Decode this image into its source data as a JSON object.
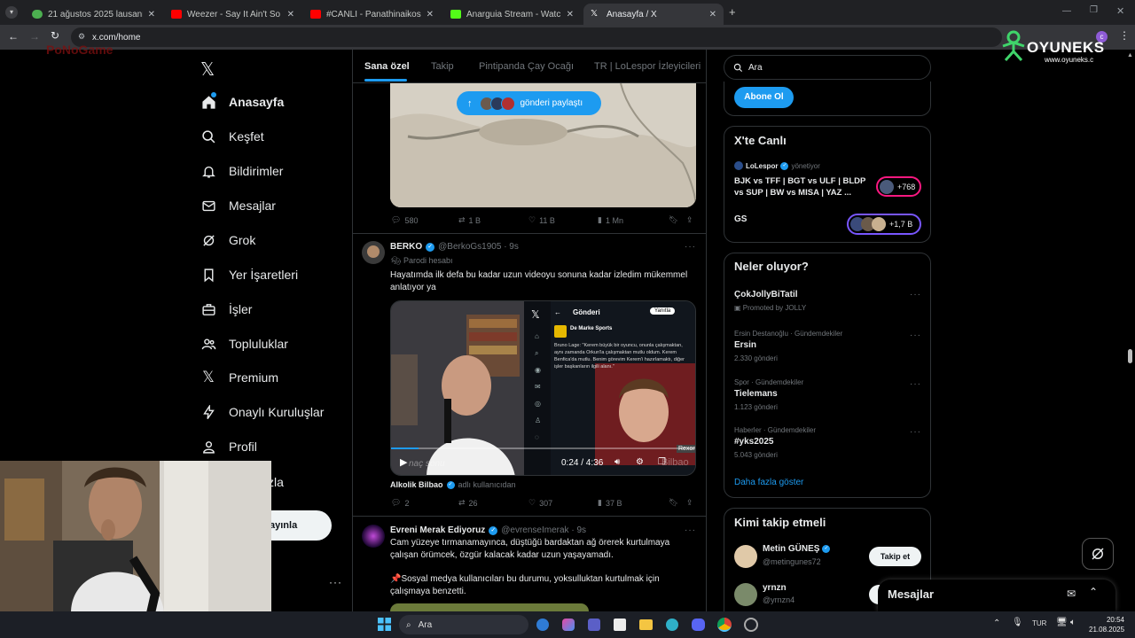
{
  "browser": {
    "tabs": [
      {
        "title": "21 ağustos 2025 lausanne-spor",
        "color": "#4caf50"
      },
      {
        "title": "Weezer - Say It Ain't So (Versio",
        "color": "#ff0000"
      },
      {
        "title": "#CANLI - Panathinaikos - Sams",
        "color": "#ff0000"
      },
      {
        "title": "Anarguia Stream - Watch Live o",
        "color": "#53fc18"
      },
      {
        "title": "Anasayfa / X",
        "color": "#ffffff"
      }
    ],
    "url": "x.com/home"
  },
  "overlay": {
    "logo_text": "OYUNEKS",
    "logo_url": "www.oyuneks.c",
    "bg_logo": "PoNoGame"
  },
  "sidebar": {
    "items": [
      {
        "label": "Anasayfa",
        "icon": "home-icon"
      },
      {
        "label": "Keşfet",
        "icon": "search-icon"
      },
      {
        "label": "Bildirimler",
        "icon": "bell-icon"
      },
      {
        "label": "Mesajlar",
        "icon": "mail-icon"
      },
      {
        "label": "Grok",
        "icon": "grok-icon"
      },
      {
        "label": "Yer İşaretleri",
        "icon": "bookmark-icon"
      },
      {
        "label": "İşler",
        "icon": "briefcase-icon"
      },
      {
        "label": "Topluluklar",
        "icon": "people-icon"
      },
      {
        "label": "Premium",
        "icon": "x-logo-icon"
      },
      {
        "label": "Onaylı Kuruluşlar",
        "icon": "lightning-icon"
      },
      {
        "label": "Profil",
        "icon": "user-icon"
      },
      {
        "label": "zla",
        "icon": ""
      }
    ],
    "post_button": "ayınla"
  },
  "feed": {
    "tabs": [
      "Sana özel",
      "Takip",
      "Pintipanda Çay Ocağı",
      "TR | LoLespor İzleyicileri"
    ],
    "new_posts_pill": "gönderi paylaştı",
    "tweet0_actions": [
      "580",
      "1 B",
      "11 B",
      "1 Mn"
    ],
    "tweet1": {
      "name": "BERKO",
      "handle": "@BerkoGs1905 · 9s",
      "sub": "Parodi hesabı",
      "text": "Hayatımda ilk defa bu kadar uzun videoyu sonuna kadar izledim mükemmel anlatıyor ya",
      "video_time": "0:24 / 4:36",
      "video_bottom_left": "naç sonu",
      "video_bottom_right": "Bilbao",
      "inner_post_header": "Gönderi",
      "inner_post_author": "De Marke Sports",
      "inner_post_text": "Bruno Lage: \"Kerem büyük bir oyuncu, onunla çalışmaktan, aynı zamanda Orkun'la çalışmaktan mutlu oldum. Kerem Benfica'da mutlu. Benim görevim Kerem'i hazırlamaktı, diğer işler başkanların ilgili alanı.\"",
      "inner_reply_btn": "Yanıtla",
      "sponsor_tag": "Rexona",
      "source_name": "Alkolik Bilbao",
      "source_sub": "adlı kullanıcıdan",
      "actions": [
        "2",
        "26",
        "307",
        "37 B"
      ]
    },
    "tweet2": {
      "name": "Evreni Merak Ediyoruz",
      "handle": "@evrenseImerak · 9s",
      "text1": "Cam yüzeye tırmanamayınca, düştüğü bardaktan ağ örerek kurtulmaya çalışan örümcek, özgür kalacak kadar uzun yaşayamadı.",
      "text2": "📌Sosyal medya kullanıcıları bu durumu, yoksulluktan kurtulmak için çalışmaya benzetti."
    }
  },
  "right": {
    "search_placeholder": "Ara",
    "subscribe_btn": "Abone Ol",
    "live_title": "X'te Canlı",
    "live_host": "LoLespor",
    "live_host_sub": "yönetiyor",
    "live_text": "BJK vs TFF | BGT vs ULF | BLDP vs SUP | BW vs MISA | YAZ ...",
    "live_count": "+768",
    "gs_label": "GS",
    "gs_count": "+1,7 B",
    "trends_title": "Neler oluyor?",
    "trends": [
      {
        "meta": "",
        "name": "ÇokJollyBiTatil",
        "sub": "Promoted by JOLLY"
      },
      {
        "meta": "Ersin Destanoğlu · Gündemdekiler",
        "name": "Ersin",
        "sub": "2.330 gönderi"
      },
      {
        "meta": "Spor · Gündemdekiler",
        "name": "Tielemans",
        "sub": "1.123 gönderi"
      },
      {
        "meta": "Haberler · Gündemdekiler",
        "name": "#yks2025",
        "sub": "5.043 gönderi"
      }
    ],
    "show_more": "Daha fazla göster",
    "follow_title": "Kimi takip etmeli",
    "follow": [
      {
        "name": "Metin GÜNEŞ",
        "handle": "@metingunes72",
        "btn": "Takip et"
      },
      {
        "name": "yrnzn",
        "handle": "@yrnzn4",
        "btn": ""
      }
    ],
    "messages_drawer": "Mesajlar"
  },
  "taskbar": {
    "search": "Ara",
    "lang": "TUR",
    "time": "20:54",
    "date": "21.08.2025"
  },
  "colors": {
    "accent": "#1d9bf0",
    "bg": "#000000",
    "border": "#2f3336",
    "muted": "#71767b"
  }
}
